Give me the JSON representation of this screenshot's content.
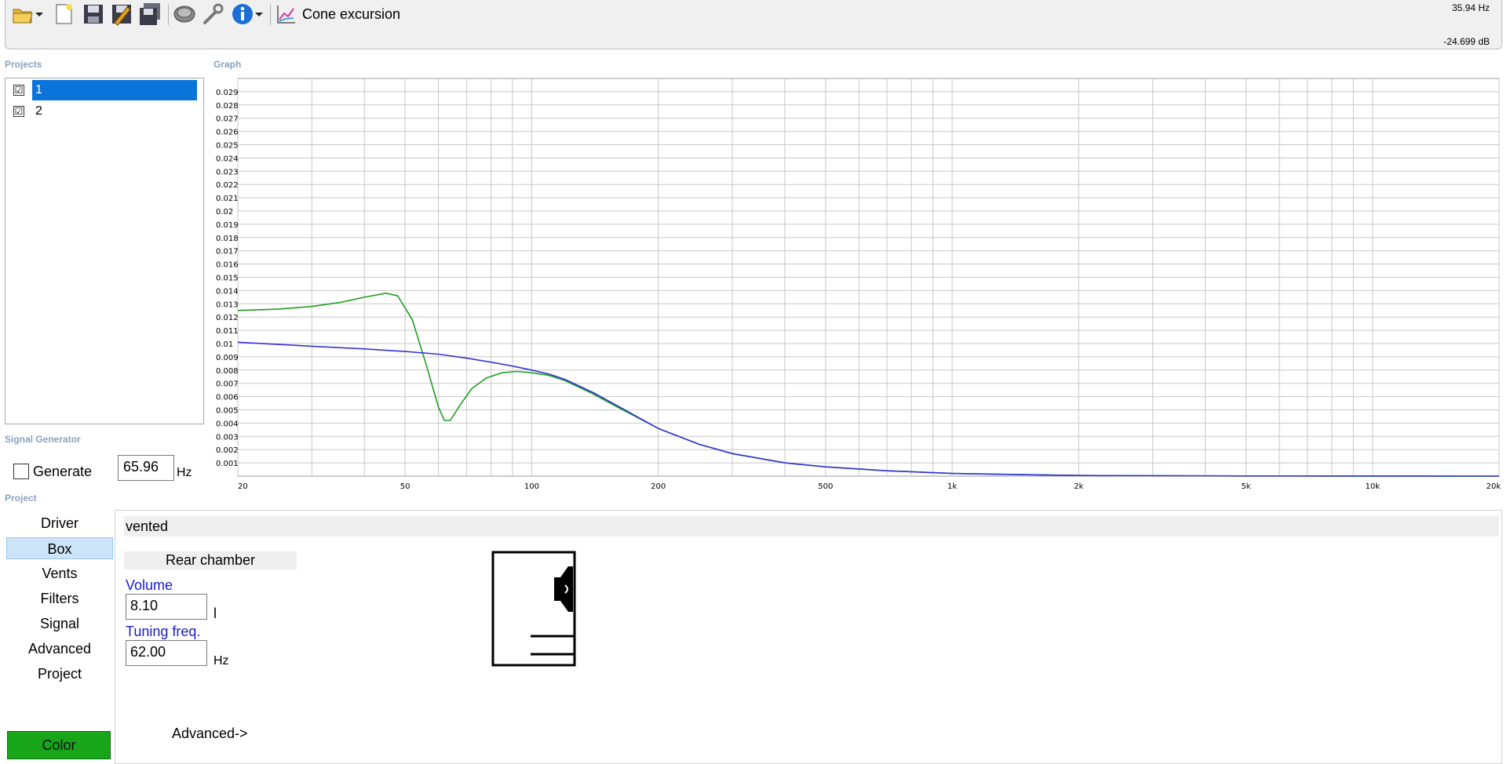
{
  "toolbar": {
    "title": "Cone excursion",
    "icons": [
      "open-folder-icon",
      "dropdown-arrow-icon",
      "new-file-icon",
      "save-icon",
      "edit-save-icon",
      "save-all-icon",
      "speaker-driver-icon",
      "wrench-icon",
      "info-icon",
      "chart-icon"
    ]
  },
  "readout": {
    "frequency": "35.94 Hz",
    "level": "-24.699 dB"
  },
  "projects": {
    "label": "Projects",
    "items": [
      {
        "name": "1",
        "checked": true,
        "selected": true
      },
      {
        "name": "2",
        "checked": true,
        "selected": false
      }
    ]
  },
  "graph": {
    "label": "Graph"
  },
  "signal_generator": {
    "label": "Signal Generator",
    "generate_label": "Generate",
    "generate_checked": false,
    "frequency": "65.96",
    "unit": "Hz"
  },
  "project": {
    "label": "Project",
    "nav": [
      "Driver",
      "Box",
      "Vents",
      "Filters",
      "Signal",
      "Advanced",
      "Project"
    ],
    "active_nav": "Box",
    "color_button": "Color",
    "color_value": "#19a519"
  },
  "box": {
    "type": "vented",
    "section": "Rear chamber",
    "volume_label": "Volume",
    "volume": "8.10",
    "volume_unit": "l",
    "tuning_label": "Tuning freq.",
    "tuning": "62.00",
    "tuning_unit": "Hz",
    "advanced": "Advanced->"
  },
  "chart_data": {
    "type": "line",
    "xscale": "log",
    "xlim": [
      20,
      20000
    ],
    "ylim": [
      0,
      0.03
    ],
    "grid": true,
    "x_tick_labels": [
      "20",
      "50",
      "100",
      "200",
      "500",
      "1k",
      "2k",
      "5k",
      "10k",
      "20k"
    ],
    "x_tick_values": [
      20,
      50,
      100,
      200,
      500,
      1000,
      2000,
      5000,
      10000,
      20000
    ],
    "y_tick_labels": [
      "0.001",
      "0.002",
      "0.003",
      "0.004",
      "0.005",
      "0.006",
      "0.007",
      "0.008",
      "0.009",
      "0.01",
      "0.011",
      "0.012",
      "0.013",
      "0.014",
      "0.015",
      "0.016",
      "0.017",
      "0.018",
      "0.019",
      "0.02",
      "0.021",
      "0.022",
      "0.023",
      "0.024",
      "0.025",
      "0.026",
      "0.027",
      "0.028",
      "0.029"
    ],
    "series": [
      {
        "color": "#1e9e1e",
        "x": [
          20,
          25,
          30,
          35,
          40,
          45,
          48,
          52,
          56,
          60,
          62,
          64,
          68,
          72,
          78,
          85,
          92,
          100,
          110,
          120,
          140,
          160,
          200,
          250,
          300,
          400,
          500,
          700,
          1000,
          2000,
          5000,
          10000,
          20000
        ],
        "y": [
          0.0125,
          0.0126,
          0.0128,
          0.0131,
          0.0135,
          0.0138,
          0.0136,
          0.0118,
          0.0085,
          0.0052,
          0.0042,
          0.0042,
          0.0055,
          0.0066,
          0.0074,
          0.0078,
          0.0079,
          0.0078,
          0.0076,
          0.0072,
          0.0062,
          0.0052,
          0.0036,
          0.0024,
          0.0017,
          0.001,
          0.0007,
          0.0004,
          0.0002,
          5e-05,
          1e-05,
          5e-06,
          2e-06
        ]
      },
      {
        "color": "#3434d6",
        "x": [
          20,
          30,
          40,
          50,
          60,
          70,
          80,
          90,
          100,
          110,
          120,
          140,
          160,
          200,
          250,
          300,
          400,
          500,
          700,
          1000,
          2000,
          5000,
          10000,
          20000
        ],
        "y": [
          0.0101,
          0.0098,
          0.0096,
          0.0094,
          0.0092,
          0.0089,
          0.0086,
          0.0083,
          0.008,
          0.0077,
          0.0073,
          0.0063,
          0.0053,
          0.0036,
          0.0024,
          0.0017,
          0.001,
          0.0007,
          0.0004,
          0.0002,
          5e-05,
          1e-05,
          5e-06,
          2e-06
        ]
      }
    ]
  }
}
